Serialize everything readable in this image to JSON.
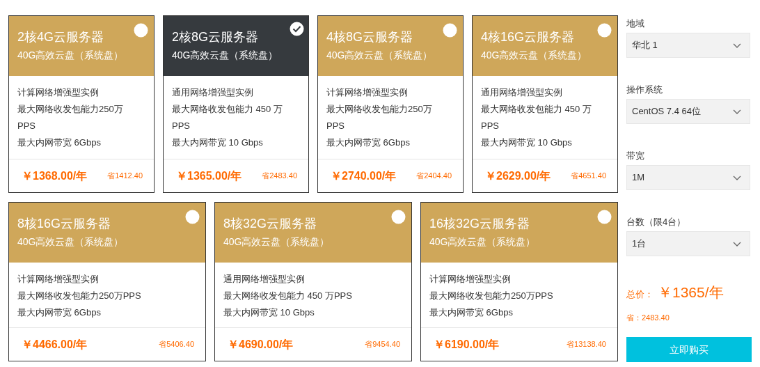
{
  "plans": [
    {
      "title": "2核4G云服务器",
      "disk": "40G高效云盘（系统盘）",
      "selected": false,
      "specs": [
        "计算网络增强型实例",
        "最大网络收发包能力250万PPS",
        "最大内网带宽 6Gbps"
      ],
      "price": "￥1368.00/年",
      "saving": "省1412.40"
    },
    {
      "title": "2核8G云服务器",
      "disk": "40G高效云盘（系统盘）",
      "selected": true,
      "specs": [
        "通用网络增强型实例",
        "最大网络收发包能力 450 万PPS",
        "最大内网带宽 10 Gbps"
      ],
      "price": "￥1365.00/年",
      "saving": "省2483.40"
    },
    {
      "title": "4核8G云服务器",
      "disk": "40G高效云盘（系统盘）",
      "selected": false,
      "specs": [
        "计算网络增强型实例",
        "最大网络收发包能力250万PPS",
        "最大内网带宽 6Gbps"
      ],
      "price": "￥2740.00/年",
      "saving": "省2404.40"
    },
    {
      "title": "4核16G云服务器",
      "disk": "40G高效云盘（系统盘）",
      "selected": false,
      "specs": [
        "通用网络增强型实例",
        "最大网络收发包能力 450 万PPS",
        "最大内网带宽 10 Gbps"
      ],
      "price": "￥2629.00/年",
      "saving": "省4651.40"
    },
    {
      "title": "8核16G云服务器",
      "disk": "40G高效云盘（系统盘）",
      "selected": false,
      "specs": [
        "计算网络增强型实例",
        "最大网络收发包能力250万PPS",
        "最大内网带宽 6Gbps"
      ],
      "price": "￥4466.00/年",
      "saving": "省5406.40"
    },
    {
      "title": "8核32G云服务器",
      "disk": "40G高效云盘（系统盘）",
      "selected": false,
      "specs": [
        "通用网络增强型实例",
        "最大网络收发包能力 450 万PPS",
        "最大内网带宽 10 Gbps"
      ],
      "price": "￥4690.00/年",
      "saving": "省9454.40"
    },
    {
      "title": "16核32G云服务器",
      "disk": "40G高效云盘（系统盘）",
      "selected": false,
      "specs": [
        "计算网络增强型实例",
        "最大网络收发包能力250万PPS",
        "最大内网带宽 6Gbps"
      ],
      "price": "￥6190.00/年",
      "saving": "省13138.40"
    }
  ],
  "options": [
    {
      "label": "地域",
      "value": "华北 1"
    },
    {
      "label": "操作系统",
      "value": "CentOS 7.4 64位"
    },
    {
      "label": "带宽",
      "value": "1M"
    },
    {
      "label": "台数（限4台）",
      "value": "1台"
    }
  ],
  "total": {
    "label": "总价：",
    "value": "￥1365/年"
  },
  "saving": "省：2483.40",
  "buy_button": "立即购买"
}
